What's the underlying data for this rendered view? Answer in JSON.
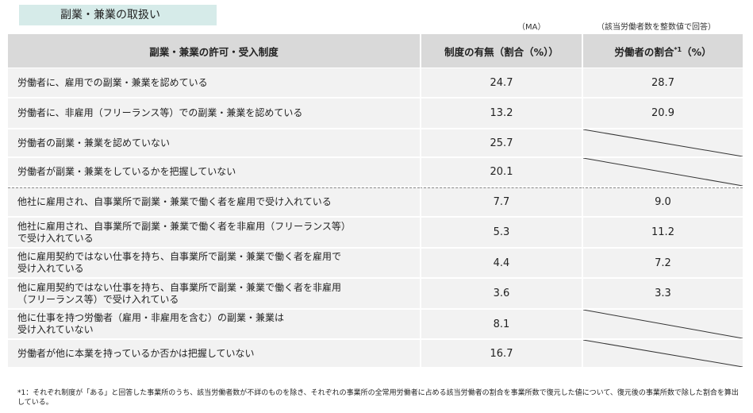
{
  "title": "副業・兼業の取扱い",
  "unit_notes": {
    "ma": "（MA）",
    "integer": "（該当労働者数を整数値で回答）"
  },
  "headers": {
    "col1": "副業・兼業の許可・受入制度",
    "col2": "制度の有無（割合（%））",
    "col3": "労働者の割合",
    "col3_sup": "*1",
    "col3_suffix": "（%）"
  },
  "rows": [
    {
      "label": "労働者に、雇用での副業・兼業を認めている",
      "rate": "24.7",
      "worker_ratio": "28.7"
    },
    {
      "label": "労働者に、非雇用（フリーランス等）での副業・兼業を認めている",
      "rate": "13.2",
      "worker_ratio": "20.9"
    },
    {
      "label": "労働者の副業・兼業を認めていない",
      "rate": "25.7",
      "worker_ratio": null
    },
    {
      "label": "労働者が副業・兼業をしているかを把握していない",
      "rate": "20.1",
      "worker_ratio": null
    },
    {
      "label": "他社に雇用され、自事業所で副業・兼業で働く者を雇用で受け入れている",
      "rate": "7.7",
      "worker_ratio": "9.0"
    },
    {
      "label_line1": "他社に雇用され、自事業所で副業・兼業で働く者を非雇用（フリーランス等）",
      "label_line2": "で受け入れている",
      "rate": "5.3",
      "worker_ratio": "11.2"
    },
    {
      "label_line1": "他に雇用契約ではない仕事を持ち、自事業所で副業・兼業で働く者を雇用で",
      "label_line2": "受け入れている",
      "rate": "4.4",
      "worker_ratio": "7.2"
    },
    {
      "label_line1": "他に雇用契約ではない仕事を持ち、自事業所で副業・兼業で働く者を非雇用",
      "label_line2": "（フリーランス等）で受け入れている",
      "rate": "3.6",
      "worker_ratio": "3.3"
    },
    {
      "label_line1": "他に仕事を持つ労働者（雇用・非雇用を含む）の副業・兼業は",
      "label_line2": "受け入れていない",
      "rate": "8.1",
      "worker_ratio": null
    },
    {
      "label": "労働者が他に本業を持っているか否かは把握していない",
      "rate": "16.7",
      "worker_ratio": null
    }
  ],
  "footnote": "*1：それぞれ制度が「ある」と回答した事業所のうち、該当労働者数が不詳のものを除き、それぞれの事業所の全常用労働者に占める該当労働者の割合を事業所数で復元した値について、復元後の事業所数で除した割合を算出している。"
}
